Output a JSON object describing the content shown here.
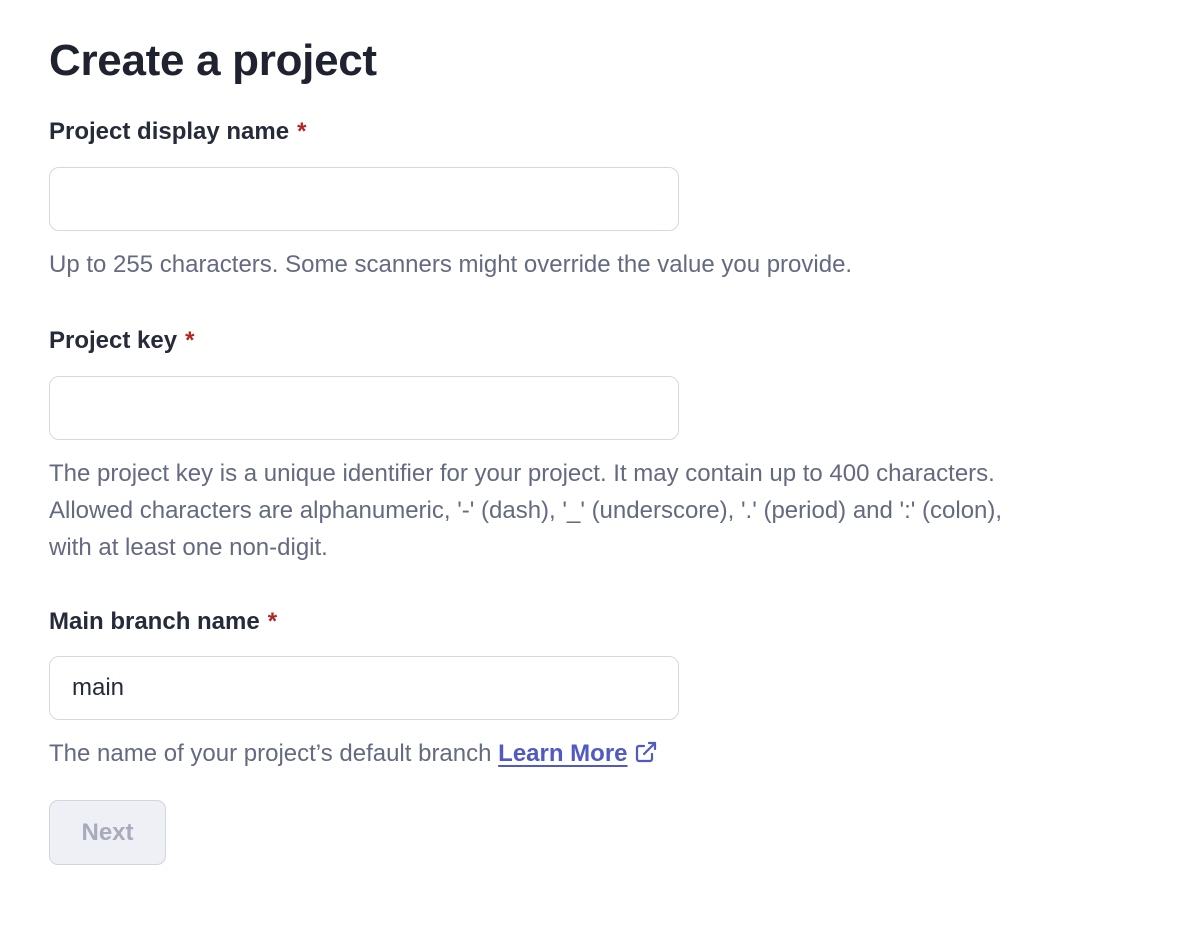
{
  "page": {
    "title": "Create a project"
  },
  "display_name": {
    "label": "Project display name",
    "required_marker": "*",
    "value": "",
    "placeholder": "",
    "help": "Up to 255 characters. Some scanners might override the value you provide."
  },
  "project_key": {
    "label": "Project key",
    "required_marker": "*",
    "value": "",
    "placeholder": "",
    "help_lines": [
      "The project key is a unique identifier for your project. It may contain up to 400 characters.",
      "Allowed characters are alphanumeric, '-' (dash), '_' (underscore), '.' (period) and ':' (colon),",
      "with at least one non-digit."
    ]
  },
  "main_branch": {
    "label": "Main branch name",
    "required_marker": "*",
    "value": "main",
    "placeholder": "",
    "help": "The name of your project’s default branch",
    "link_label": "Learn More",
    "link_icon": "external-link-icon"
  },
  "actions": {
    "next_label": "Next",
    "next_enabled": false
  },
  "colors": {
    "required": "#b3261e",
    "link": "#5059c4",
    "help_text": "#646a7f",
    "disabled_button_bg": "#eff0f5",
    "disabled_button_text": "#a7abbc"
  }
}
